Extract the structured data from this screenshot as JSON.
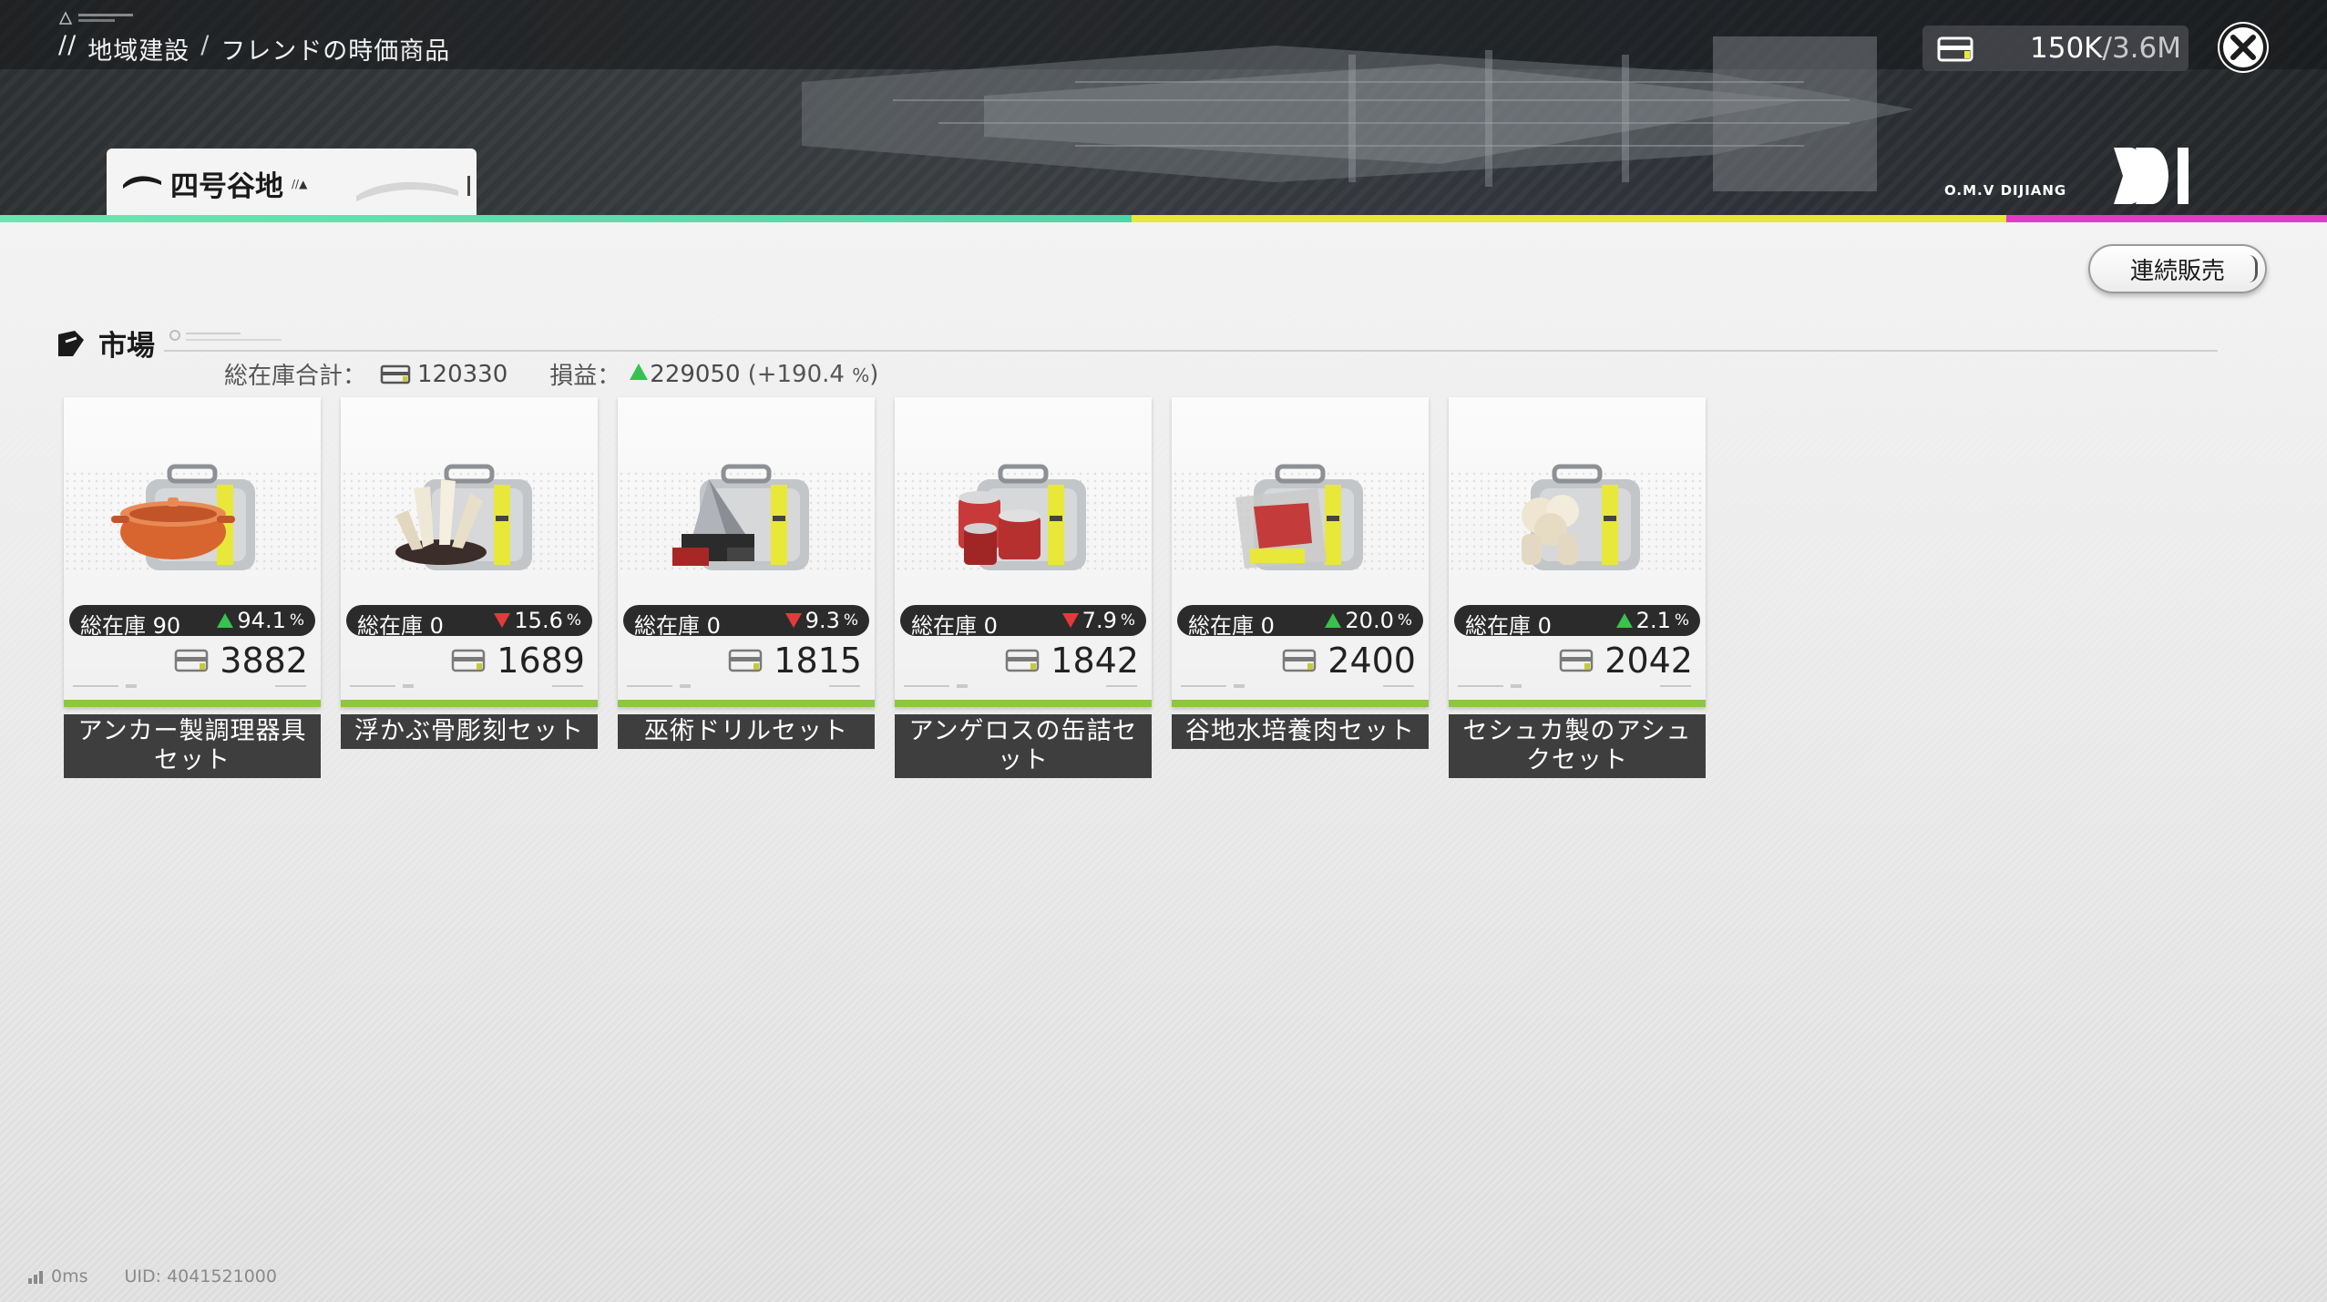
{
  "breadcrumb": {
    "prefix": "//",
    "level1": "地域建設",
    "separator": "/",
    "level2": "フレンドの時価商品"
  },
  "currency": {
    "current": "150K",
    "max": "/3.6M"
  },
  "logo": {
    "name": "O.M.V DIJIANG"
  },
  "region_tab": {
    "name": "四号谷地",
    "suffix": "//▲"
  },
  "toolbar": {
    "continuous_sell_label": "連続販売"
  },
  "market": {
    "title": "市場",
    "total_stock_label": "総在庫合計：",
    "total_stock_value": "120330",
    "profit_label": "損益：",
    "profit_value": "229050",
    "profit_pct_open": "(+190.4",
    "profit_pct_unit": "%",
    "profit_pct_close": ")"
  },
  "items": [
    {
      "name": "アンカー製調理器具セット",
      "stock": "総在庫 90",
      "change": "94.1",
      "direction": "up",
      "price": "3882",
      "icon": "cooking-pot-icon"
    },
    {
      "name": "浮かぶ骨彫刻セット",
      "stock": "総在庫 0",
      "change": "15.6",
      "direction": "down",
      "price": "1689",
      "icon": "bone-sculpture-icon"
    },
    {
      "name": "巫術ドリルセット",
      "stock": "総在庫 0",
      "change": "9.3",
      "direction": "down",
      "price": "1815",
      "icon": "drill-icon"
    },
    {
      "name": "アンゲロスの缶詰セット",
      "stock": "総在庫 0",
      "change": "7.9",
      "direction": "down",
      "price": "1842",
      "icon": "canned-food-icon"
    },
    {
      "name": "谷地水培養肉セット",
      "stock": "総在庫 0",
      "change": "20.0",
      "direction": "up",
      "price": "2400",
      "icon": "cultured-meat-icon"
    },
    {
      "name": "セシュカ製のアシュクセット",
      "stock": "総在庫 0",
      "change": "2.1",
      "direction": "up",
      "price": "2042",
      "icon": "flower-ornament-icon"
    }
  ],
  "percent_unit": "%",
  "footer": {
    "ping": "0ms",
    "uid": "UID: 4041521000"
  },
  "colors": {
    "accent_green": "#8fc540",
    "up": "#37c24d",
    "down": "#e23b3b",
    "line_teal": "#4fd6a8",
    "line_yellow": "#e8e83a",
    "line_magenta": "#e33cc4"
  }
}
